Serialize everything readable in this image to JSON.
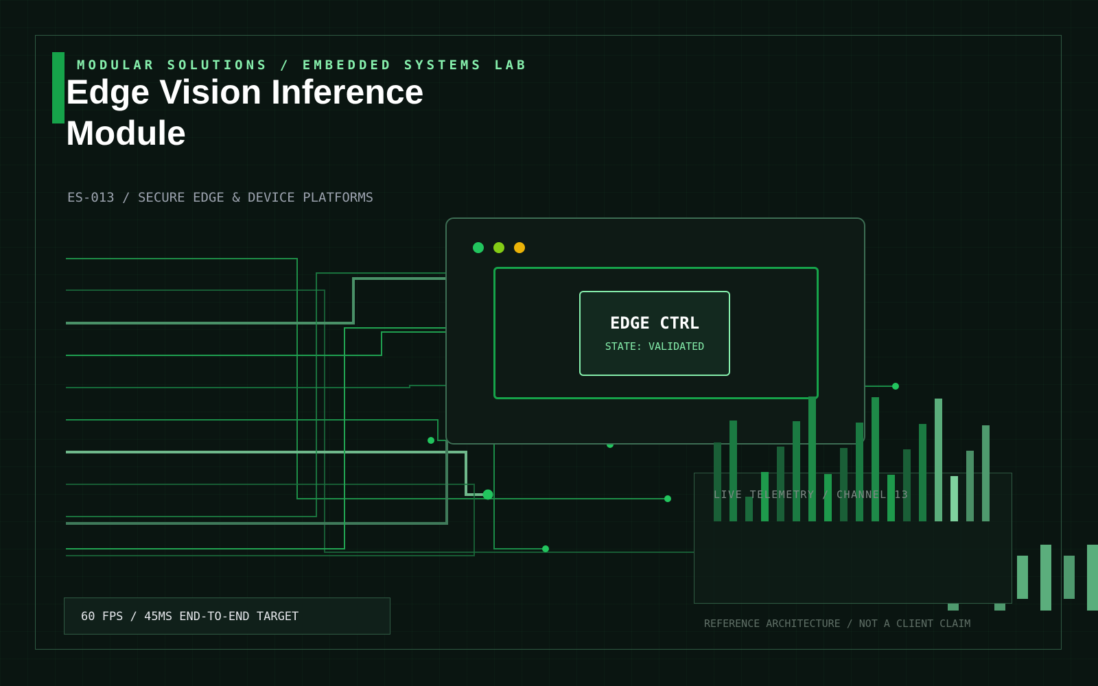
{
  "header": {
    "eyebrow": "MODULAR SOLUTIONS / EMBEDDED SYSTEMS LAB",
    "title": "Edge Vision Inference Module",
    "subtitle": "ES-013 / SECURE EDGE & DEVICE PLATFORMS"
  },
  "device_window": {
    "window_dots": [
      "green",
      "lime",
      "amber"
    ],
    "card_title": "EDGE CTRL",
    "card_state": "STATE: VALIDATED"
  },
  "telemetry": {
    "label": "LIVE TELEMETRY / CHANNEL 13"
  },
  "target_badge": "60 FPS / 45MS END-TO-END TARGET",
  "footer_note": "REFERENCE ARCHITECTURE / NOT A CLIENT CLAIM",
  "colors": {
    "background": "#0a1511",
    "accent": "#16a34a",
    "accent_light": "#86efac",
    "dot_green": "#22c55e",
    "dot_lime": "#84cc16",
    "dot_amber": "#eab308"
  },
  "icons": [
    "window-dot-green-icon",
    "window-dot-lime-icon",
    "window-dot-amber-icon"
  ]
}
